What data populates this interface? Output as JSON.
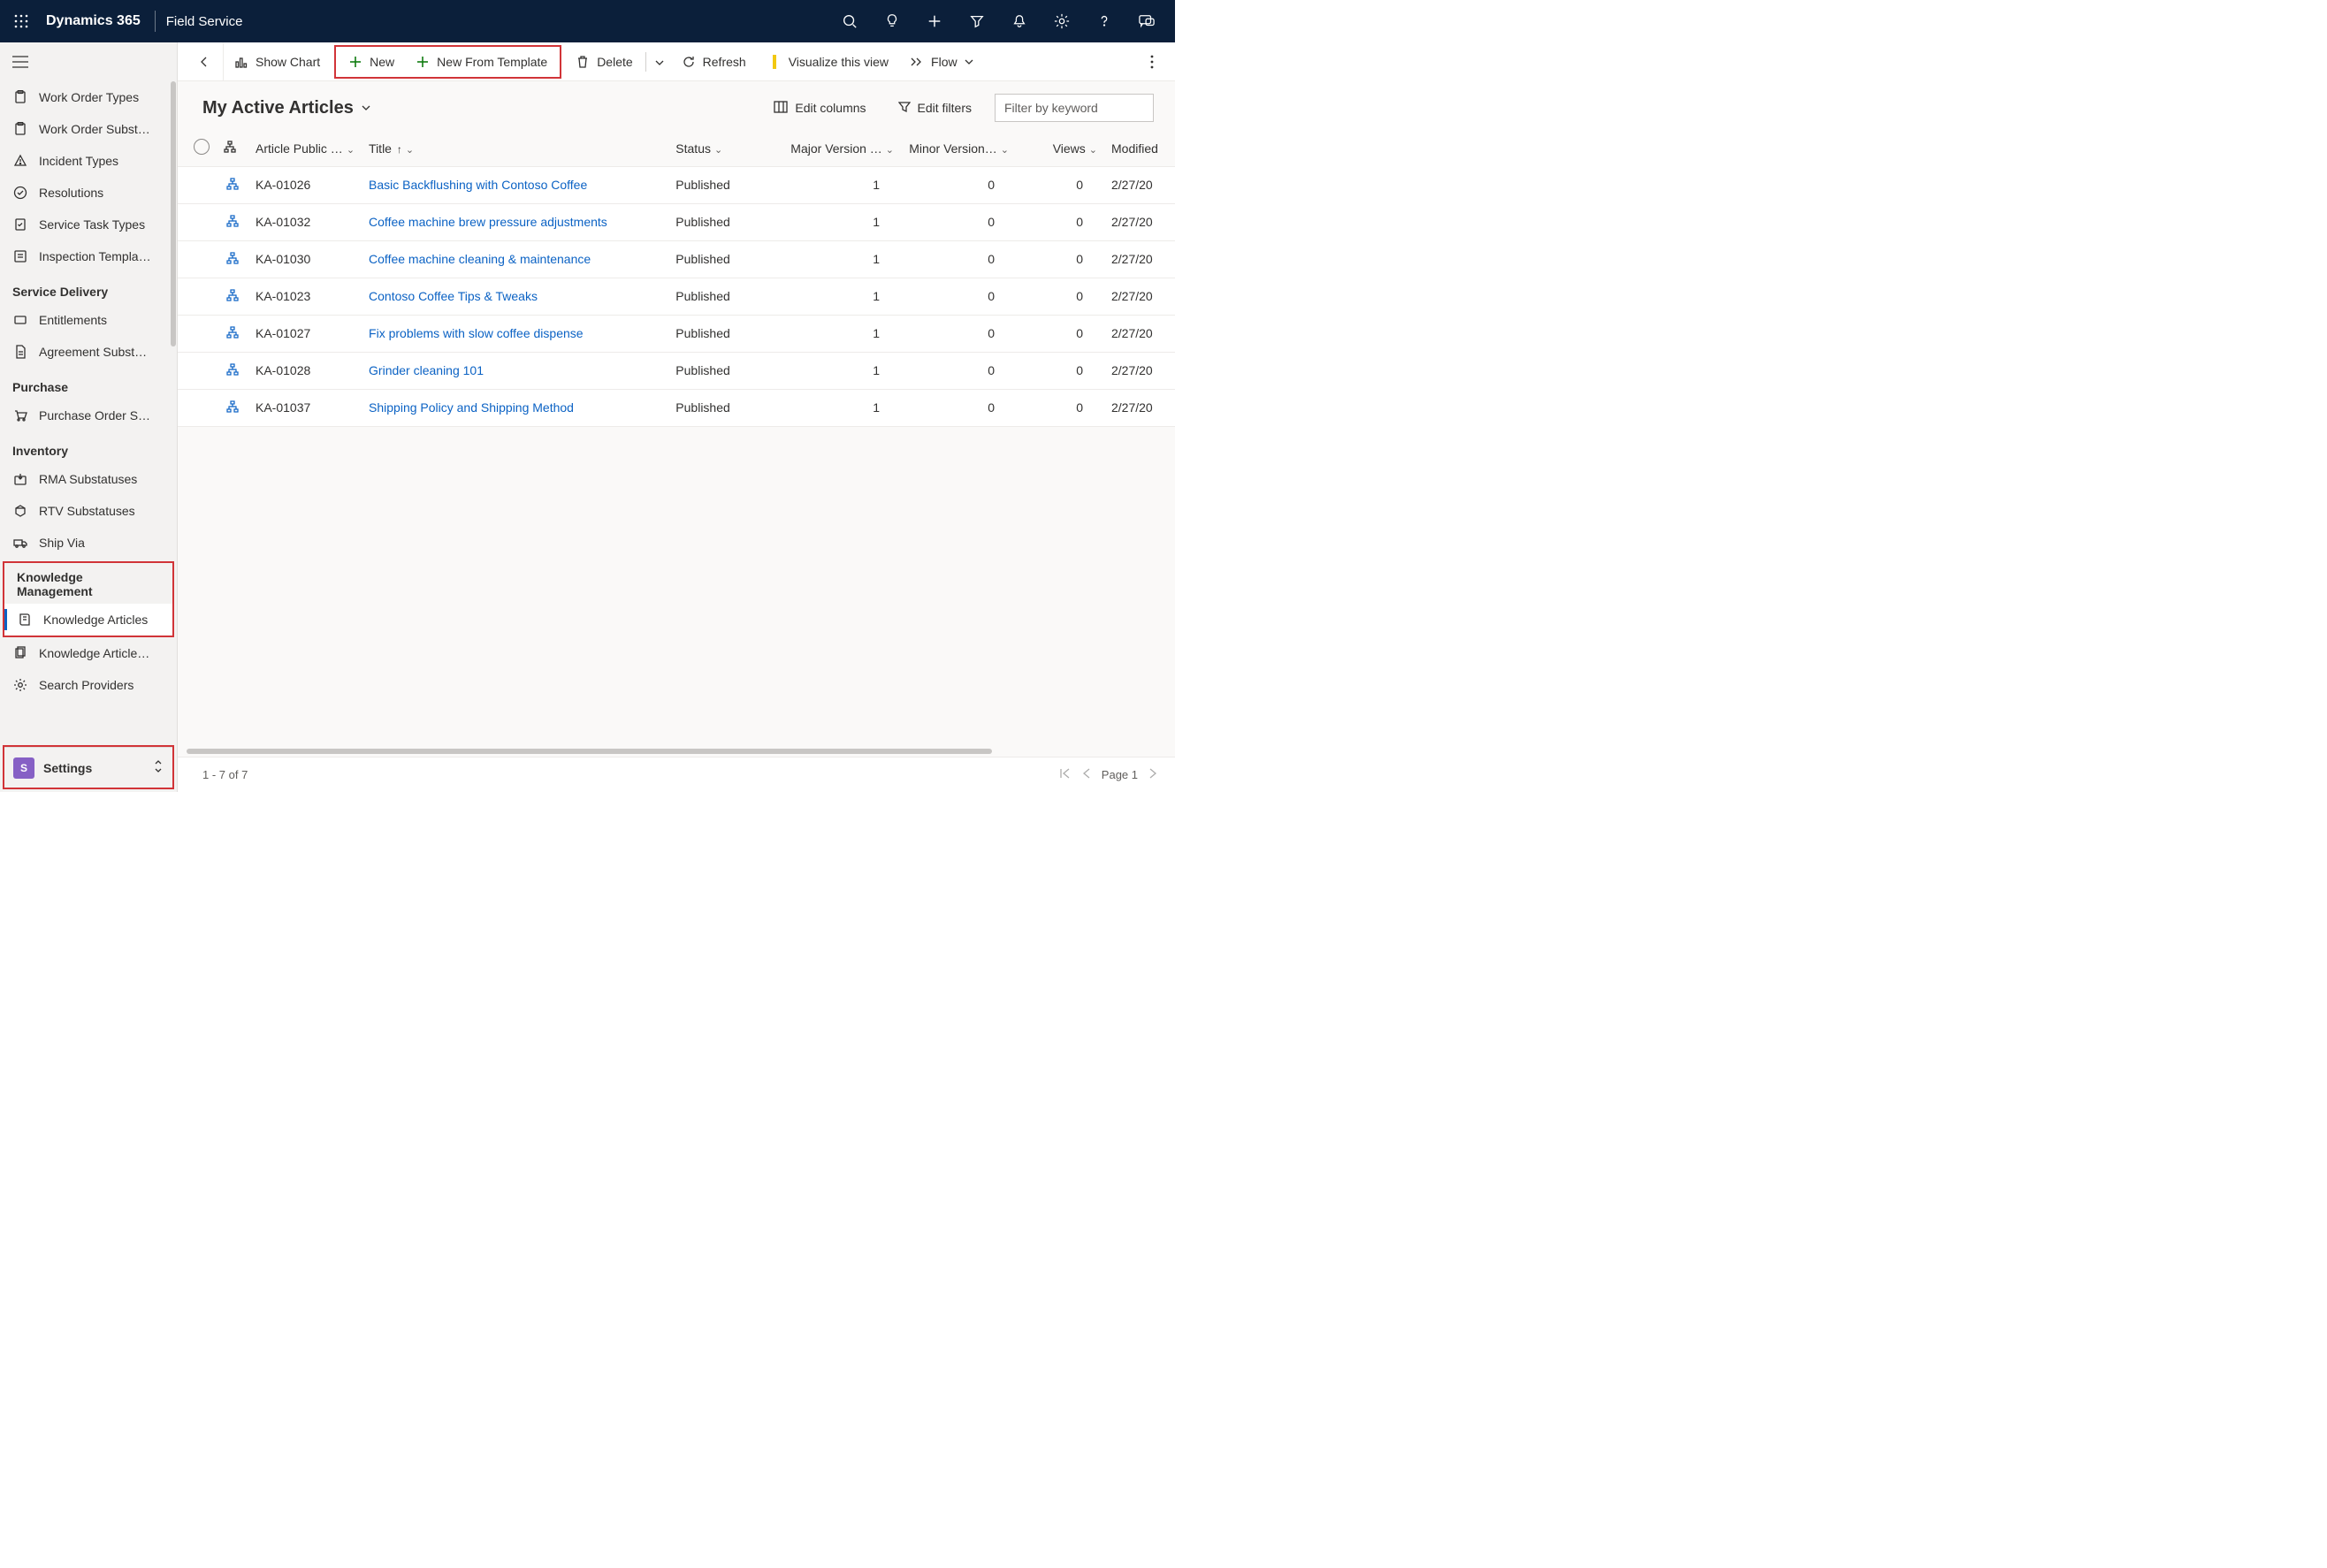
{
  "header": {
    "app_title": "Dynamics 365",
    "module": "Field Service"
  },
  "sidebar": {
    "items_top": [
      {
        "label": "Work Order Types"
      },
      {
        "label": "Work Order Subst…"
      },
      {
        "label": "Incident Types"
      },
      {
        "label": "Resolutions"
      },
      {
        "label": "Service Task Types"
      },
      {
        "label": "Inspection Templa…"
      }
    ],
    "group_service_title": "Service Delivery",
    "items_service": [
      {
        "label": "Entitlements"
      },
      {
        "label": "Agreement Subst…"
      }
    ],
    "group_purchase_title": "Purchase",
    "items_purchase": [
      {
        "label": "Purchase Order S…"
      }
    ],
    "group_inventory_title": "Inventory",
    "items_inventory": [
      {
        "label": "RMA Substatuses"
      },
      {
        "label": "RTV Substatuses"
      },
      {
        "label": "Ship Via"
      }
    ],
    "group_knowledge_title": "Knowledge Management",
    "items_knowledge": [
      {
        "label": "Knowledge Articles"
      },
      {
        "label": "Knowledge Article…"
      },
      {
        "label": "Search Providers"
      }
    ],
    "area": {
      "badge": "S",
      "label": "Settings"
    }
  },
  "commandbar": {
    "show_chart": "Show Chart",
    "new": "New",
    "new_from_template": "New From Template",
    "delete": "Delete",
    "refresh": "Refresh",
    "visualize": "Visualize this view",
    "flow": "Flow"
  },
  "view": {
    "title": "My Active Articles",
    "edit_columns": "Edit columns",
    "edit_filters": "Edit filters",
    "filter_placeholder": "Filter by keyword"
  },
  "columns": {
    "article_public": "Article Public …",
    "title": "Title",
    "status": "Status",
    "major": "Major Version …",
    "minor": "Minor Version…",
    "views": "Views",
    "modified": "Modified"
  },
  "rows": [
    {
      "id": "KA-01026",
      "title": "Basic Backflushing with Contoso Coffee",
      "status": "Published",
      "major": "1",
      "minor": "0",
      "views": "0",
      "modified": "2/27/20"
    },
    {
      "id": "KA-01032",
      "title": "Coffee machine brew pressure adjustments",
      "status": "Published",
      "major": "1",
      "minor": "0",
      "views": "0",
      "modified": "2/27/20"
    },
    {
      "id": "KA-01030",
      "title": "Coffee machine cleaning & maintenance",
      "status": "Published",
      "major": "1",
      "minor": "0",
      "views": "0",
      "modified": "2/27/20"
    },
    {
      "id": "KA-01023",
      "title": "Contoso Coffee Tips & Tweaks",
      "status": "Published",
      "major": "1",
      "minor": "0",
      "views": "0",
      "modified": "2/27/20"
    },
    {
      "id": "KA-01027",
      "title": "Fix problems with slow coffee dispense",
      "status": "Published",
      "major": "1",
      "minor": "0",
      "views": "0",
      "modified": "2/27/20"
    },
    {
      "id": "KA-01028",
      "title": "Grinder cleaning 101",
      "status": "Published",
      "major": "1",
      "minor": "0",
      "views": "0",
      "modified": "2/27/20"
    },
    {
      "id": "KA-01037",
      "title": "Shipping Policy and Shipping Method",
      "status": "Published",
      "major": "1",
      "minor": "0",
      "views": "0",
      "modified": "2/27/20"
    }
  ],
  "footer": {
    "range": "1 - 7 of 7",
    "page": "Page 1"
  }
}
